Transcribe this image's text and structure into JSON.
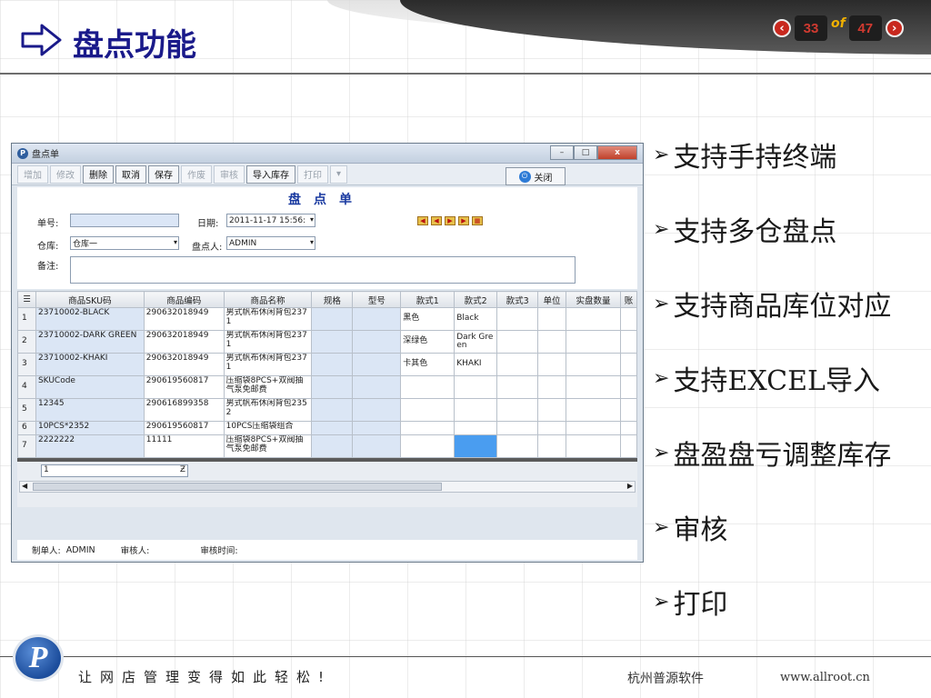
{
  "header": {
    "title": "盘点功能",
    "current_page": "33",
    "of_label": "of",
    "total_pages": "47",
    "prev_glyph": "‹",
    "next_glyph": "›"
  },
  "window": {
    "title": "盘点单",
    "min_glyph": "–",
    "max_glyph": "□",
    "close_glyph": "x",
    "toolbar": {
      "add": "增加",
      "edit": "修改",
      "delete": "删除",
      "cancel": "取消",
      "save": "保存",
      "void": "作废",
      "audit": "审核",
      "import": "导入库存",
      "print": "打印",
      "close": "关闭"
    },
    "form": {
      "title": "盘点单",
      "order_no_label": "单号:",
      "order_no_value": "",
      "date_label": "日期:",
      "date_value": "2011-11-17 15:56:",
      "warehouse_label": "仓库:",
      "warehouse_value": "仓库一",
      "counter_label": "盘点人:",
      "counter_value": "ADMIN",
      "memo_label": "备注:",
      "memo_value": ""
    },
    "table": {
      "columns": [
        "商品SKU码",
        "商品编码",
        "商品名称",
        "规格",
        "型号",
        "款式1",
        "款式2",
        "款式3",
        "单位",
        "实盘数量",
        "账"
      ],
      "rows": [
        [
          "1",
          "23710002-BLACK",
          "290632018949",
          "男式帆布休闲背包2371",
          "",
          "",
          "黑色",
          "Black",
          "",
          "",
          "",
          ""
        ],
        [
          "2",
          "23710002-DARK GREEN",
          "290632018949",
          "男式帆布休闲背包2371",
          "",
          "",
          "深绿色",
          "Dark Green",
          "",
          "",
          "",
          ""
        ],
        [
          "3",
          "23710002-KHAKI",
          "290632018949",
          "男式帆布休闲背包2371",
          "",
          "",
          "卡其色",
          "KHAKI",
          "",
          "",
          "",
          ""
        ],
        [
          "4",
          "SKUCode",
          "290619560817",
          "压缩袋8PCS+双阀抽气泵免邮费",
          "",
          "",
          "",
          "",
          "",
          "",
          "",
          ""
        ],
        [
          "5",
          "12345",
          "290616899358",
          "男式帆布休闲背包2352",
          "",
          "",
          "",
          "",
          "",
          "",
          "",
          ""
        ],
        [
          "6",
          "10PCS*2352",
          "290619560817",
          "10PCS压缩袋组合",
          "",
          "",
          "",
          "",
          "",
          "",
          "",
          ""
        ],
        [
          "7",
          "2222222",
          "11111",
          "压缩袋8PCS+双阀抽气泵免邮费",
          "",
          "",
          "",
          "",
          "",
          "",
          "",
          ""
        ]
      ]
    },
    "filter_value": "1",
    "status": {
      "maker_label": "制单人:",
      "maker_value": "ADMIN",
      "auditor_label": "审核人:",
      "auditor_value": "",
      "audit_time_label": "审核时间:",
      "audit_time_value": ""
    }
  },
  "bullets": [
    "支持手持终端",
    "支持多仓盘点",
    "支持商品库位对应",
    "支持EXCEL导入",
    "盘盈盘亏调整库存",
    "审核",
    "打印"
  ],
  "footer": {
    "logo_letter": "P",
    "slogan": "让网店管理变得如此轻松!",
    "company": "杭州普源软件",
    "website": "www.allroot.cn"
  }
}
